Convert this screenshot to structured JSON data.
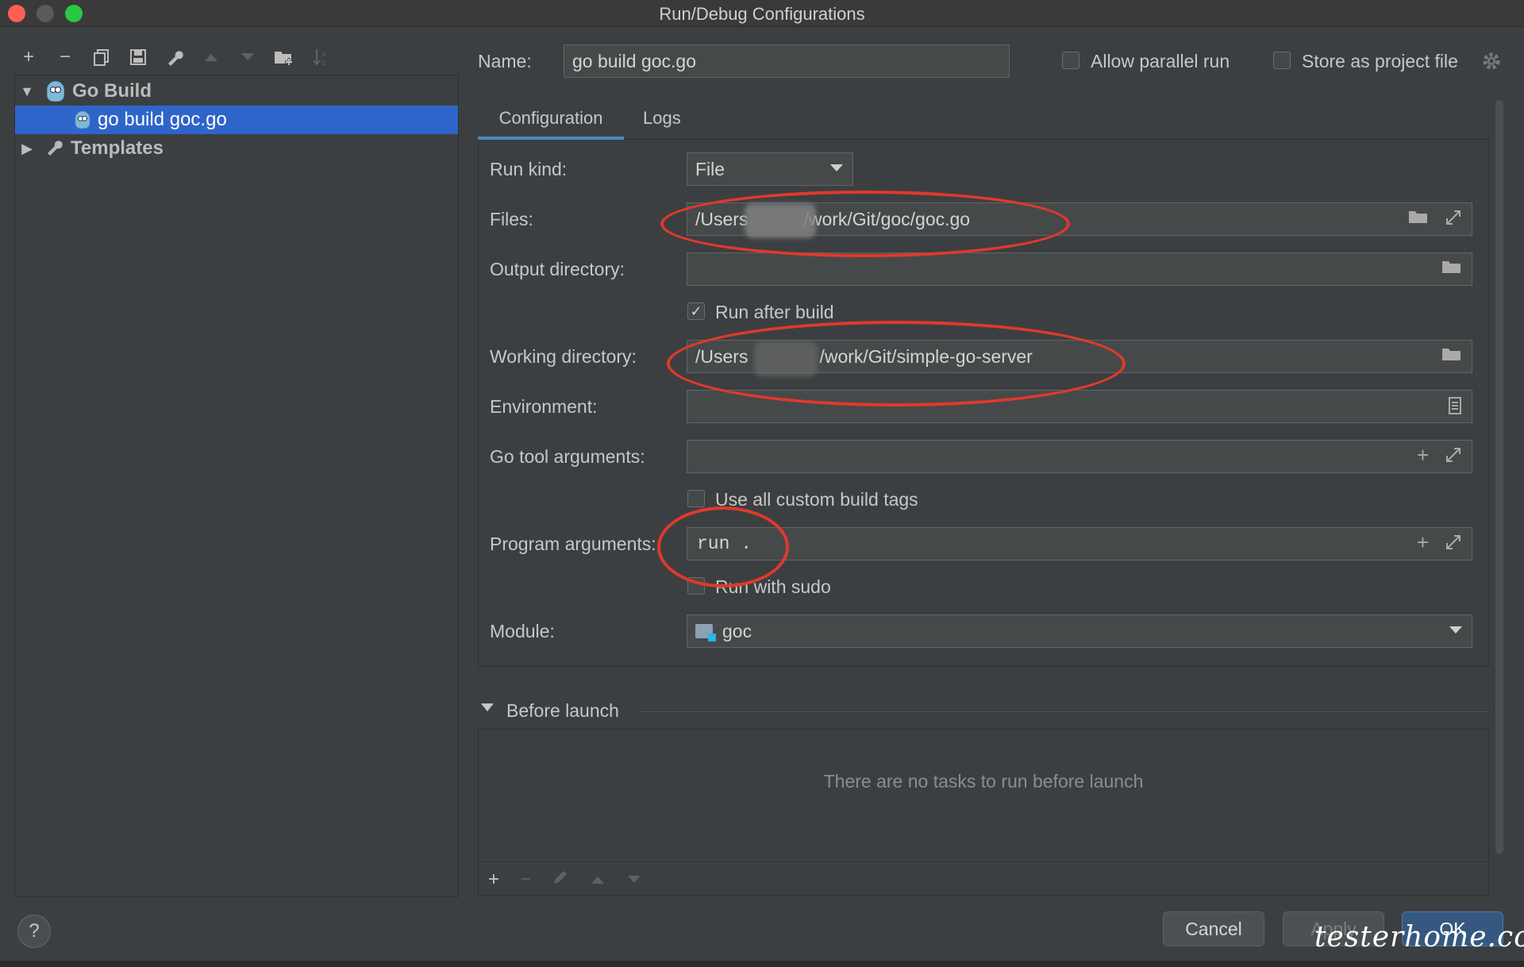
{
  "window": {
    "title": "Run/Debug Configurations"
  },
  "left_toolbar": {
    "icons": [
      "add-icon",
      "remove-icon",
      "copy-icon",
      "save-icon",
      "wrench-icon",
      "move-up-icon",
      "move-down-icon",
      "new-folder-icon",
      "sort-icon"
    ]
  },
  "tree": {
    "group_label": "Go Build",
    "selected_item": "go build goc.go",
    "templates_label": "Templates"
  },
  "header": {
    "name_label": "Name:",
    "name_value": "go build goc.go",
    "allow_parallel_label": "Allow parallel run",
    "store_project_label": "Store as project file"
  },
  "tabs": [
    "Configuration",
    "Logs"
  ],
  "form": {
    "run_kind_label": "Run kind:",
    "run_kind_value": "File",
    "files_label": "Files:",
    "files_value_start": "/Users",
    "files_value_end": "/work/Git/goc/goc.go",
    "output_dir_label": "Output directory:",
    "run_after_build_label": "Run after build",
    "working_dir_label": "Working directory:",
    "working_dir_value_start": "/Users",
    "working_dir_value_end": "/work/Git/simple-go-server",
    "environment_label": "Environment:",
    "go_tool_args_label": "Go tool arguments:",
    "use_custom_tags_label": "Use all custom build tags",
    "program_args_label": "Program arguments:",
    "program_args_value": "run .",
    "run_with_sudo_label": "Run with sudo",
    "module_label": "Module:",
    "module_value": "goc"
  },
  "before_launch": {
    "title": "Before launch",
    "empty_message": "There are no tasks to run before launch"
  },
  "footer": {
    "help": "?",
    "cancel": "Cancel",
    "apply": "Apply",
    "ok": "OK",
    "watermark": "testerhome.com"
  },
  "colors": {
    "selection": "#2f65ca",
    "annotation": "#e0392b",
    "tab_underline": "#4a88c7"
  }
}
